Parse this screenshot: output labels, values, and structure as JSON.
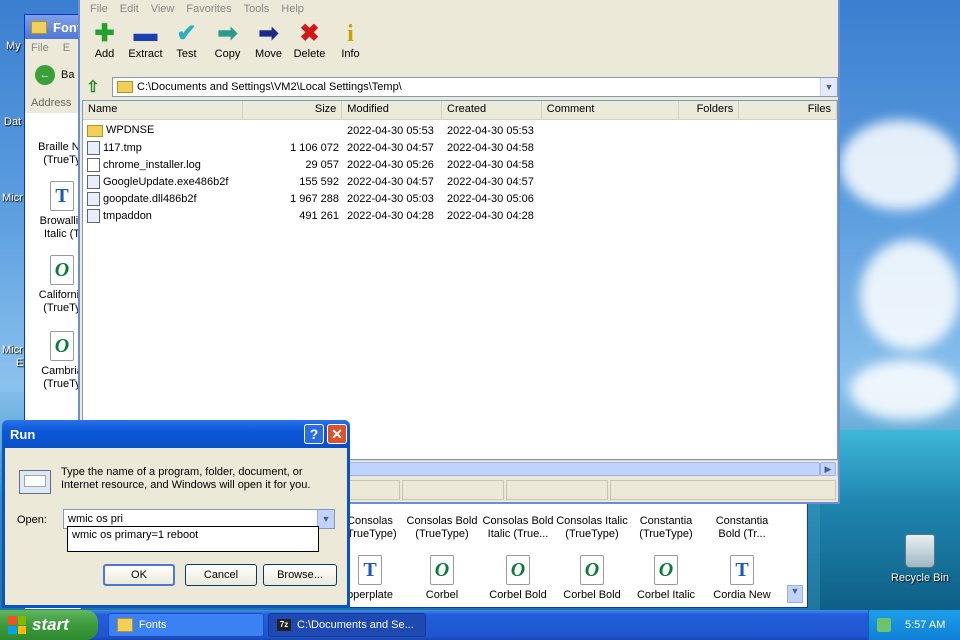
{
  "desktop": {
    "labels": [
      "My",
      "Dat",
      "Micr",
      "Micr",
      "E"
    ],
    "recycle_bin_label": "Recycle Bin"
  },
  "fonts_window": {
    "title": "Fonts",
    "menu": [
      "File",
      "E"
    ],
    "back_label": "Ba",
    "address_label": "Address",
    "left_items": [
      {
        "label": "Braille No\n(TrueTy"
      },
      {
        "label": "Browallia\nItalic (T"
      },
      {
        "label": "California\n(TrueTy"
      },
      {
        "label": "Cambria\n(TrueTy"
      }
    ],
    "row1": [
      {
        "label": "Consolas\n(TrueType)"
      },
      {
        "label": "Consolas Bold\n(TrueType)"
      },
      {
        "label": "Consolas Bold\nItalic (True..."
      },
      {
        "label": "Consolas Italic\n(TrueType)"
      },
      {
        "label": "Constantia\n(TrueType)"
      },
      {
        "label": "Constantia\nBold (Tr..."
      }
    ],
    "row2": [
      {
        "label": "pperplate"
      },
      {
        "label": "Corbel"
      },
      {
        "label": "Corbel Bold"
      },
      {
        "label": "Corbel Bold"
      },
      {
        "label": "Corbel Italic"
      },
      {
        "label": "Cordia New"
      }
    ]
  },
  "zip_window": {
    "menu": [
      "File",
      "Edit",
      "View",
      "Favorites",
      "Tools",
      "Help"
    ],
    "toolbar": [
      {
        "label": "Add",
        "icon": "add-icon",
        "glyph": "✚",
        "color": "#22a22a"
      },
      {
        "label": "Extract",
        "icon": "extract-icon",
        "glyph": "▬",
        "color": "#1a3fb0"
      },
      {
        "label": "Test",
        "icon": "test-icon",
        "glyph": "✔",
        "color": "#2ab0c0"
      },
      {
        "label": "Copy",
        "icon": "copy-icon",
        "glyph": "➡",
        "color": "#2a9a8a"
      },
      {
        "label": "Move",
        "icon": "move-icon",
        "glyph": "➡",
        "color": "#1a2a8a"
      },
      {
        "label": "Delete",
        "icon": "delete-icon",
        "glyph": "✖",
        "color": "#d01818"
      },
      {
        "label": "Info",
        "icon": "info-icon",
        "glyph": "i",
        "color": "#c8a000"
      }
    ],
    "path": "C:\\Documents and Settings\\VM2\\Local Settings\\Temp\\",
    "columns": {
      "name": "Name",
      "size": "Size",
      "modified": "Modified",
      "created": "Created",
      "comment": "Comment",
      "folders": "Folders",
      "files": "Files"
    },
    "rows": [
      {
        "name": "WPDNSE",
        "size": "",
        "modified": "2022-04-30 05:53",
        "created": "2022-04-30 05:53",
        "type": "folder"
      },
      {
        "name": "117.tmp",
        "size": "1 106 072",
        "modified": "2022-04-30 04:57",
        "created": "2022-04-30 04:58",
        "type": "dll"
      },
      {
        "name": "chrome_installer.log",
        "size": "29 057",
        "modified": "2022-04-30 05:26",
        "created": "2022-04-30 04:58",
        "type": "file"
      },
      {
        "name": "GoogleUpdate.exe486b2f",
        "size": "155 592",
        "modified": "2022-04-30 04:57",
        "created": "2022-04-30 04:57",
        "type": "dll"
      },
      {
        "name": "goopdate.dll486b2f",
        "size": "1 967 288",
        "modified": "2022-04-30 05:03",
        "created": "2022-04-30 05:06",
        "type": "dll"
      },
      {
        "name": "tmpaddon",
        "size": "491 261",
        "modified": "2022-04-30 04:28",
        "created": "2022-04-30 04:28",
        "type": "dll"
      }
    ]
  },
  "run_dialog": {
    "title": "Run",
    "help_glyph": "?",
    "close_glyph": "✕",
    "description": "Type the name of a program, folder, document, or Internet resource, and Windows will open it for you.",
    "open_label": "Open:",
    "input_value": "wmic os pri",
    "suggestion": "wmic os primary=1 reboot",
    "ok_label": "OK",
    "cancel_label": "Cancel",
    "browse_label": "Browse..."
  },
  "taskbar": {
    "start_label": "start",
    "tasks": [
      {
        "label": "Fonts"
      },
      {
        "label": "C:\\Documents and Se..."
      }
    ],
    "clock": "5:57 AM"
  }
}
